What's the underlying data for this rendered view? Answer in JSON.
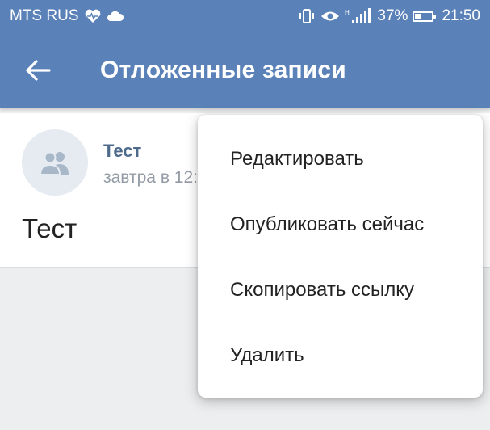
{
  "status_bar": {
    "carrier": "MTS RUS",
    "signal_label": "H",
    "battery_percent_text": "37%",
    "battery_level": 0.37,
    "time": "21:50",
    "icons": [
      "heart-pulse-icon",
      "cloud-icon",
      "vibrate-icon",
      "eye-icon",
      "signal-icon",
      "battery-icon"
    ]
  },
  "toolbar": {
    "title": "Отложенные записи",
    "back_icon": "arrow-left-icon"
  },
  "post": {
    "author": "Тест",
    "time": "завтра в 12:00",
    "text": "Тест",
    "avatar_icon": "group-icon"
  },
  "context_menu": {
    "items": [
      {
        "label": "Редактировать"
      },
      {
        "label": "Опубликовать сейчас"
      },
      {
        "label": "Скопировать ссылку"
      },
      {
        "label": "Удалить"
      }
    ]
  },
  "colors": {
    "header": "#5a82b9",
    "background": "#edeef0",
    "author": "#4d6a8d",
    "muted": "#939ca6"
  }
}
